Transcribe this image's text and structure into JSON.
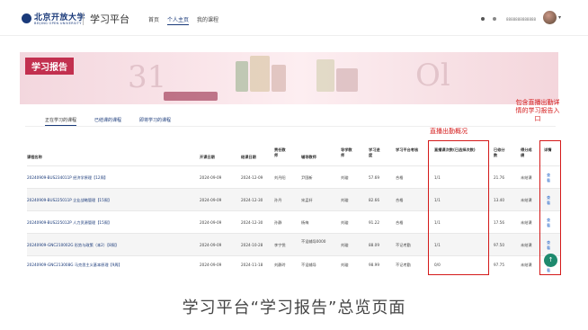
{
  "header": {
    "logo_cn": "北京开放大学",
    "logo_en": "BEIJING OPEN UNIVERSITY",
    "platform_title": "学习平台",
    "nav": [
      "首页",
      "个人主页",
      "我的课程"
    ],
    "username": "8888888888888"
  },
  "banner": {
    "title": "学习报告"
  },
  "tabs": [
    "正在学习的课程",
    "已结课的课程",
    "即将学习的课程"
  ],
  "annotations": {
    "attendance": "直播出勤概况",
    "details": "包含直播出勤详情的学习报告入口"
  },
  "table": {
    "headers": [
      "课程名称",
      "开课日期",
      "结课日期",
      "责任教师",
      "辅导教师",
      "导学教师",
      "学习进度",
      "学习平台考核",
      "直播课次数(已选择次数)",
      "已修分数",
      "得分成绩",
      "详情"
    ],
    "rows": [
      [
        "20240909-BUS234011P 经济学原理【12周】",
        "2024-09-09",
        "2024-12-09",
        "刘丹阳",
        "尹国新",
        "刘璇",
        "57.69",
        "合格",
        "1/1",
        "21.76",
        "未结课",
        "查看"
      ],
      [
        "20240909-BUS225011P 企业战略管理【15周】",
        "2024-09-09",
        "2024-12-30",
        "孙丹",
        "宋孟轩",
        "刘璇",
        "82.66",
        "合格",
        "1/1",
        "13.40",
        "未结课",
        "查看"
      ],
      [
        "20240909-BUS225012P 人力资源管理【15周】",
        "2024-09-09",
        "2024-12-30",
        "孙静",
        "杨梅",
        "刘璇",
        "91.22",
        "合格",
        "1/1",
        "17.56",
        "未结课",
        "查看"
      ],
      [
        "20240909-GNC210002G 形势与政策（本2）【8周】",
        "2024-09-09",
        "2024-10-28",
        "李宁悦",
        "不设辅导0000",
        "刘璇",
        "88.09",
        "不记考勤",
        "1/1",
        "97.50",
        "未结课",
        "查看"
      ],
      [
        "20240909-GNC213008G 马克思主义基本原理【9周】",
        "2024-09-09",
        "2024-11-18",
        "刘静玲",
        "不设辅导",
        "刘璇",
        "98.99",
        "不记考勤",
        "0/0",
        "97.75",
        "未结课",
        "查看"
      ]
    ]
  },
  "fab_icon": "arrow-up-icon",
  "caption": "学习平台“学习报告”总览页面"
}
